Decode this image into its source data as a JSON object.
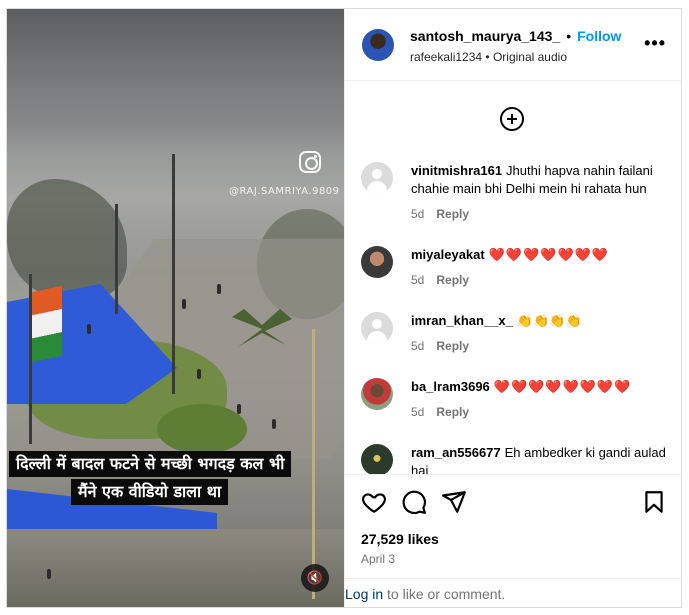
{
  "post": {
    "username": "santosh_maurya_143_",
    "separator": "•",
    "follow_label": "Follow",
    "audio_owner": "rafeekali1234",
    "audio_label": "Original audio",
    "more_icon": "more-options-icon"
  },
  "video": {
    "watermark_handle": "@RAJ.SAMRIYA.9809",
    "caption_line1": "दिल्ली में बादल फटने से मच्छी भगदड़ कल भी",
    "caption_line2": "मैंने एक वीडियो डाला था",
    "mute_icon": "🔇"
  },
  "comments": [
    {
      "user": "vinitmishra161",
      "text": "Jhuthi hapva nahin failani chahie main bhi Delhi mein hi rahata hun",
      "age": "5d",
      "reply": "Reply"
    },
    {
      "user": "miyaleyakat",
      "text": "❤️❤️❤️❤️❤️❤️❤️",
      "age": "5d",
      "reply": "Reply"
    },
    {
      "user": "imran_khan__x_",
      "text": "👏👏👏👏",
      "age": "5d",
      "reply": "Reply"
    },
    {
      "user": "ba_lram3696",
      "text": "❤️❤️❤️❤️❤️❤️❤️❤️",
      "age": "5d",
      "reply": "Reply"
    },
    {
      "user": "ram_an556677",
      "text": "Eh ambedker ki gandi aulad hai",
      "age": "",
      "reply": ""
    }
  ],
  "engagement": {
    "likes": "27,529 likes",
    "date": "April 3"
  },
  "footer": {
    "login_link": "Log in",
    "login_rest": " to like or comment."
  },
  "colors": {
    "accent": "#0095f6",
    "heart": "#ed1c3a",
    "muted_text": "#737373",
    "link": "#00376b"
  }
}
